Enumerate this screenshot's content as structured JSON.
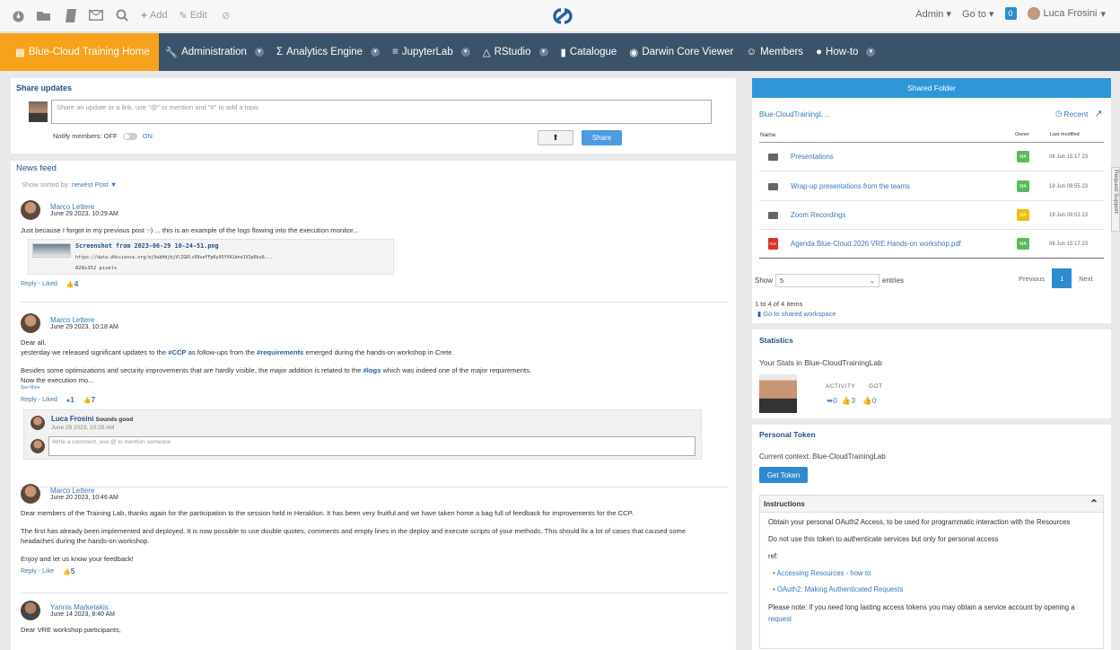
{
  "topbar": {
    "add_label": "Add",
    "edit_label": "Edit",
    "admin_label": "Admin",
    "goto_label": "Go to",
    "badge": "0",
    "user_name": "Luca Frosini"
  },
  "nav": {
    "items": [
      "Blue-Cloud Training Home",
      "Administration",
      "Analytics Engine",
      "JupyterLab",
      "RStudio",
      "Catalogue",
      "Darwin Core Viewer",
      "Members",
      "How-to"
    ]
  },
  "share": {
    "title": "Share updates",
    "placeholder": "Share an update or a link, use \"@\" to mention and \"#\" to add a topic",
    "notify_label": "Notify members: OFF",
    "notify_on": "ON",
    "share_button": "Share"
  },
  "feed": {
    "title": "News feed",
    "sorted_label": "Show sorted by:",
    "sorted_value": "newest Post",
    "posts": [
      {
        "author": "Marco Lettere",
        "date": "June 29 2023, 10:29 AM",
        "text": "Just because I forgot in my previous post :-) ... this is an example of the logs flowing into the execution monitor...",
        "attachment_name": "Screenshot from 2023-06-29 10-24-51.png",
        "attachment_url": "https://data.d4science.org/ejVwbHdjbjVlZGRlc09seFFpKy95YVA1dno1V3p6bz8...",
        "attachment_size": "828x352 pixels",
        "reply": "Reply",
        "like": "Liked",
        "likes": "4"
      },
      {
        "author": "Marco Lettere",
        "date": "June 29 2023, 10:18 AM",
        "line1": "Dear all,",
        "line2_a": "yesterday we released significant updates to the",
        "line2_tag1": "#CCP",
        "line2_b": "as follow-ups from the",
        "line2_tag2": "#requirements",
        "line2_c": "emerged during the hands-on workshop in Crete.",
        "line3_a": "Besides some optimizations and security improvements that are hardly visible, the major addition is related to the",
        "line3_tag": "#logs",
        "line3_b": "which was indeed one of the major requirements.",
        "line4": "Now the execution mo...",
        "see_more": "See More",
        "reply": "Reply",
        "like": "Liked",
        "comments": "1",
        "likes": "7",
        "comment_author": "Luca Frosini",
        "comment_text": "Sounds good",
        "comment_date": "June 29 2023, 10:28 AM",
        "comment_placeholder": "Write a comment, use @ to mention someone"
      },
      {
        "author": "Marco Lettere",
        "date": "June 20 2023, 10:46 AM",
        "p1": "Dear members of the Training Lab, thanks again for the participation to the session held in Heraklion. It has been very fruitful and we have taken home a bag full of feedback for improvements for the CCP.",
        "p2": "The first has already been implemented and deployed. It is now possible to use double quotes, comments and empty lines in the deploy and execute scripts of your methods. This should fix a lot of cases that caused some headaches during the hands-on workshop.",
        "p3": "Enjoy and let us know your feedback!",
        "reply": "Reply",
        "like": "Like",
        "likes": "5"
      },
      {
        "author": "Yannis Marketakis",
        "date": "June 14 2023, 8:40 AM",
        "text": "Dear VRE workshop participants,"
      }
    ]
  },
  "folder": {
    "header": "Shared Folder",
    "path": "Blue-CloudTrainingL ...",
    "recent": "Recent",
    "col_name": "Name",
    "col_owner": "Owner",
    "col_modified": "Last modified",
    "rows": [
      {
        "name": "Presentations",
        "owner": "MA",
        "date": "06 Jun 15:17 23"
      },
      {
        "name": "Wrap-up presentations from the teams",
        "owner": "MA",
        "date": "19 Jun 09:55 23"
      },
      {
        "name": "Zoom Recordings",
        "owner": "MA",
        "date": "19 Jun 09:53 23"
      },
      {
        "name": "Agenda Blue-Cloud 2026 VRE Hands-on workshop.pdf",
        "owner": "MA",
        "date": "06 Jun 15:17 23"
      }
    ],
    "show_label": "Show",
    "show_value": "5",
    "entries_label": "entries",
    "prev": "Previous",
    "page": "1",
    "next": "Next",
    "count_text": "1 to 4 of 4 items",
    "goto_workspace": "Go to shared workspace",
    "badge_green": "#5cb85c",
    "badge_yellow": "#f0c000"
  },
  "stats": {
    "title": "Statistics",
    "subtitle": "Your Stats in Blue-CloudTrainingLab",
    "activity_label": "ACTIVITY",
    "got_label": "GOT",
    "activity_a": "0",
    "activity_b": "3",
    "got_value": "0"
  },
  "token": {
    "title": "Personal Token",
    "context": "Current context: Blue-CloudTrainingLab",
    "button": "Get Token",
    "instructions_title": "Instructions",
    "line1": "Obtain your personal OAuth2 Access, to be used for programmatic interaction with the Resources",
    "line2": "Do not use this token to authenticate services but only for personal access",
    "ref": "ref:",
    "link1": "Accessing Resources - how to",
    "link2": "OAuth2: Making Authenticated Requests",
    "note": "Please note: if you need long lasting access tokens you may obtain a service account by opening a",
    "note_link": "request"
  },
  "side_tab": "Request Support"
}
